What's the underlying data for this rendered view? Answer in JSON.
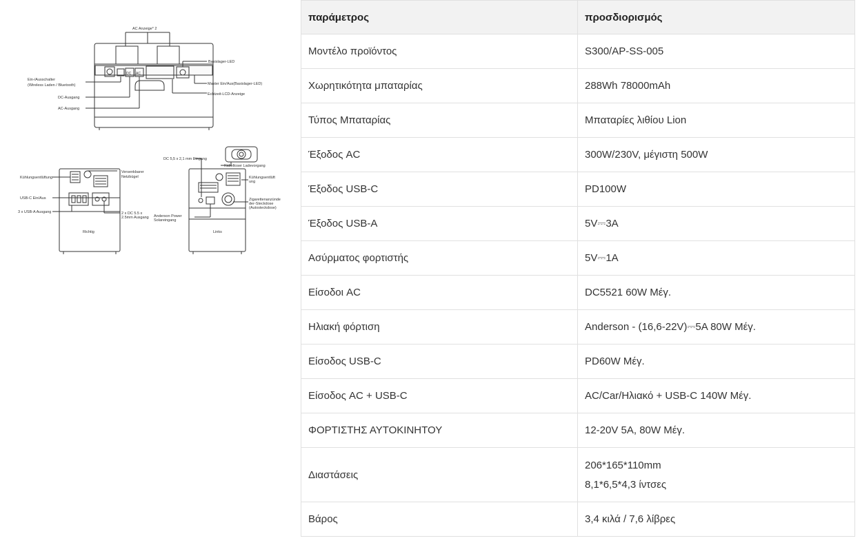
{
  "diagram": {
    "front": {
      "ac_display": "AC Anzeige* 2",
      "base_led": "Basislager-LED",
      "on_off_switch_1": "Ein-/Ausschalter",
      "on_off_switch_2": "(Wireless Laden / Bluetooth)",
      "master_switch": "Master Ein/Aus(Basislager-LED)",
      "lcd_display": "Echtzeit-LCD-Anzeige",
      "dc_output": "DC-Ausgang",
      "ac_output": "AC-Ausgang",
      "dc_button": "DC",
      "ac_button": "AC"
    },
    "right": {
      "cooling_vent": "Kühlungsentlüftung",
      "handle_1": "Versenkbarer",
      "handle_2": "Netzbügel",
      "usbc_switch": "USB-C Ein/Aus",
      "usba_output": "3 x USB-A Ausgang",
      "dc_out_1": "2 x DC 5.5 x",
      "dc_out_2": "2.5mm Ausgang",
      "side_label": "Richtig"
    },
    "left": {
      "dc_input": "DC 5,5 x 2,1 mm Eingang",
      "wireless_charging": "Kabelloser Ladevorgang",
      "cooling_vent_1": "Kühlungsentlüft",
      "cooling_vent_2": "ung",
      "cigarette_1": "Zigarettenanzünde",
      "cigarette_2": "der-Steckdose",
      "cigarette_3": "(Autosteckdose)",
      "anderson_1": "Anderson Power",
      "anderson_2": "Solareingang",
      "side_label": "Links"
    }
  },
  "table": {
    "header": [
      "παράμετρος",
      "προσδιορισμός"
    ],
    "rows": [
      {
        "param": "Μοντέλο προϊόντος",
        "value": "S300/AP-SS-005"
      },
      {
        "param": "Χωρητικότητα μπαταρίας",
        "value": "288Wh 78000mAh"
      },
      {
        "param": "Τύπος Μπαταρίας",
        "value": "Μπαταρίες λιθίου Lion"
      },
      {
        "param": "Έξοδος AC",
        "value": "300W/230V, μέγιστη 500W"
      },
      {
        "param": "Έξοδος USB-C",
        "value": "PD100W"
      },
      {
        "param": "Έξοδος USB-A",
        "value": "5V⎓3A"
      },
      {
        "param": "Ασύρματος φορτιστής",
        "value": "5V⎓1A"
      },
      {
        "param": "Είσοδοι AC",
        "value": "DC5521 60W Μέγ."
      },
      {
        "param": "Ηλιακή φόρτιση",
        "value": "Anderson - (16,6-22V)⎓5A 80W Μέγ."
      },
      {
        "param": "Είσοδος USB-C",
        "value": "PD60W Μέγ."
      },
      {
        "param": "Είσοδος AC + USB-C",
        "value": "AC/Car/Ηλιακό + USB-C 140W Μέγ."
      },
      {
        "param": "ΦΟΡΤΙΣΤΗΣ ΑΥΤΟΚΙΝΗΤΟΥ",
        "value": "12-20V 5A, 80W Μέγ."
      },
      {
        "param": "Διαστάσεις",
        "value": "206*165*110mm",
        "value2": "8,1*6,5*4,3 ίντσες"
      },
      {
        "param": "Βάρος",
        "value": "3,4 κιλά / 7,6 λίβρες"
      }
    ]
  }
}
